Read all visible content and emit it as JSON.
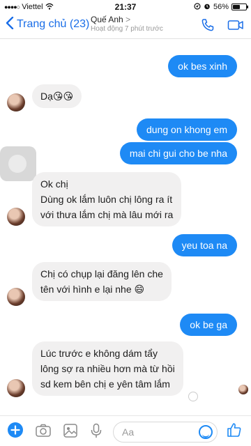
{
  "status_bar": {
    "carrier": "Viettel",
    "time": "21:37",
    "battery": "56%"
  },
  "header": {
    "back_label": "Trang chủ (23)",
    "contact_name": "Quế Anh",
    "contact_chevron": ">",
    "contact_status": "Hoạt động 7 phút trước"
  },
  "messages": [
    {
      "from": "me",
      "text": "ok bes xinh"
    },
    {
      "from": "them",
      "text": "Dạ😘😘"
    },
    {
      "from": "me",
      "text": "dung on khong em"
    },
    {
      "from": "me",
      "text": "mai chi gui cho be nha"
    },
    {
      "from": "them",
      "lines": [
        "Ok chị",
        "Dùng ok lắm luôn chị lông ra ít",
        "với thưa lắm chị mà lâu mới ra"
      ]
    },
    {
      "from": "me",
      "text": "yeu toa na"
    },
    {
      "from": "them",
      "lines": [
        "Chị có chụp lại đăng lên che",
        "tên với hình e lại nhe 😄"
      ]
    },
    {
      "from": "me",
      "text": "ok be ga"
    },
    {
      "from": "them",
      "lines": [
        "Lúc trước e không dám tẩy",
        "lông sợ ra nhiều hơn mà từ hồi",
        "sd kem bên chị e yên tâm lắm"
      ]
    }
  ],
  "composer": {
    "placeholder": "Aa"
  },
  "colors": {
    "accent": "#1e8af5",
    "incoming_bubble": "#f1f0f0"
  }
}
